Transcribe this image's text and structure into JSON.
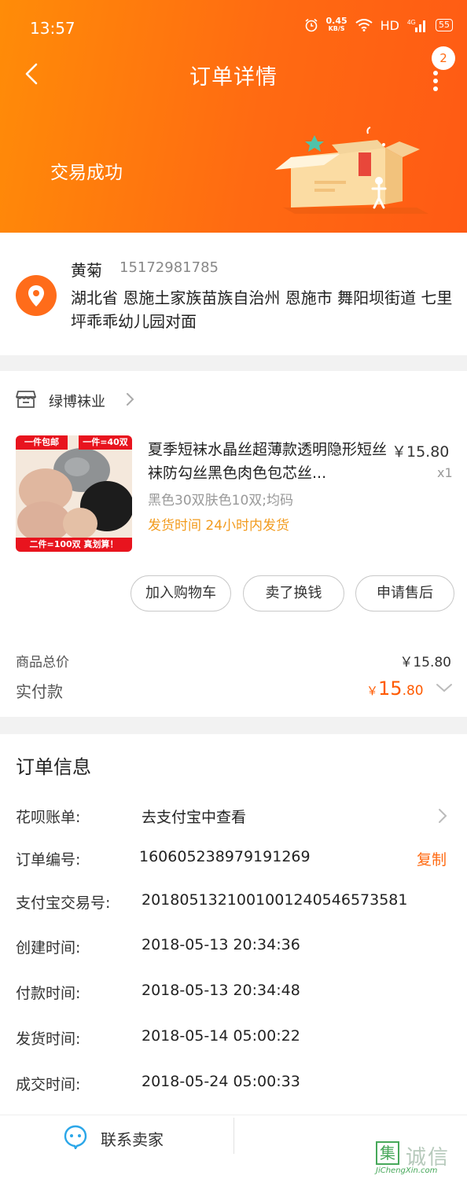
{
  "status_bar": {
    "time": "13:57",
    "net_speed_value": "0.45",
    "net_speed_unit": "KB/S",
    "hd": "HD",
    "signal": "4G",
    "battery": "55",
    "icons": [
      "alarm-icon",
      "wifi-icon",
      "signal-icon",
      "battery-icon"
    ]
  },
  "header": {
    "title": "订单详情",
    "badge_count": "2",
    "order_status": "交易成功",
    "colors": {
      "gradient_start": "#ff8c08",
      "gradient_end": "#ff5a14"
    }
  },
  "address": {
    "name": "黄菊",
    "phone": "15172981785",
    "detail": "湖北省 恩施土家族苗族自治州 恩施市 舞阳坝街道 七里坪乖乖幼儿园对面",
    "icon": "location-pin-icon"
  },
  "shop": {
    "name": "绿博袜业",
    "icon": "store-icon"
  },
  "item": {
    "title": "夏季短袜水晶丝超薄款透明隐形短丝袜防勾丝黑色肉色包芯丝...",
    "price": "￥15.80",
    "quantity": "x1",
    "spec": "黑色30双肤色10双;均码",
    "shipping": "发货时间 24小时内发货",
    "image_tags": {
      "top_left": "一件包邮",
      "top_right": "一件=40双",
      "bottom": "二件=100双  真划算！"
    }
  },
  "actions": [
    {
      "label": "加入购物车"
    },
    {
      "label": "卖了换钱"
    },
    {
      "label": "申请售后"
    }
  ],
  "summary": {
    "total_label": "商品总价",
    "total_value": "￥15.80",
    "paid_label": "实付款",
    "paid_currency": "￥",
    "paid_integer": "15",
    "paid_decimal": ".80",
    "accent_color": "#ff5a00"
  },
  "order_info": {
    "heading": "订单信息",
    "rows": [
      {
        "key": "花呗账单:",
        "value": "去支付宝中查看"
      },
      {
        "key": "订单编号:",
        "value": "160605238979191269"
      },
      {
        "key": "支付宝交易号:",
        "value": "2018051321001001240546573581"
      },
      {
        "key": "创建时间:",
        "value": "2018-05-13 20:34:36"
      },
      {
        "key": "付款时间:",
        "value": "2018-05-13 20:34:48"
      },
      {
        "key": "发货时间:",
        "value": "2018-05-14 05:00:22"
      },
      {
        "key": "成交时间:",
        "value": "2018-05-24 05:00:33"
      }
    ],
    "copy_label": "复制"
  },
  "bottom_bar": {
    "contact_label": "联系卖家"
  },
  "watermark": {
    "glyph": "集",
    "text": "诚信",
    "url": "JiChengXin.com"
  }
}
